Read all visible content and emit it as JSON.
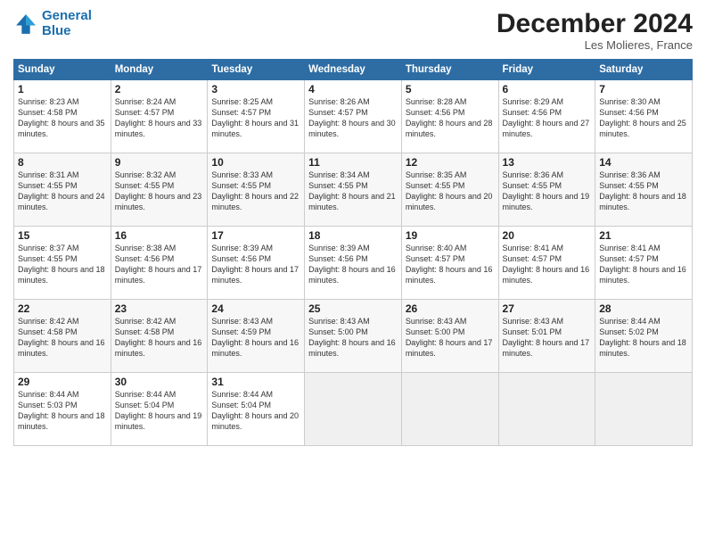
{
  "header": {
    "logo_line1": "General",
    "logo_line2": "Blue",
    "month": "December 2024",
    "location": "Les Molieres, France"
  },
  "weekdays": [
    "Sunday",
    "Monday",
    "Tuesday",
    "Wednesday",
    "Thursday",
    "Friday",
    "Saturday"
  ],
  "weeks": [
    [
      {
        "day": "1",
        "sunrise": "8:23 AM",
        "sunset": "4:58 PM",
        "daylight": "8 hours and 35 minutes."
      },
      {
        "day": "2",
        "sunrise": "8:24 AM",
        "sunset": "4:57 PM",
        "daylight": "8 hours and 33 minutes."
      },
      {
        "day": "3",
        "sunrise": "8:25 AM",
        "sunset": "4:57 PM",
        "daylight": "8 hours and 31 minutes."
      },
      {
        "day": "4",
        "sunrise": "8:26 AM",
        "sunset": "4:57 PM",
        "daylight": "8 hours and 30 minutes."
      },
      {
        "day": "5",
        "sunrise": "8:28 AM",
        "sunset": "4:56 PM",
        "daylight": "8 hours and 28 minutes."
      },
      {
        "day": "6",
        "sunrise": "8:29 AM",
        "sunset": "4:56 PM",
        "daylight": "8 hours and 27 minutes."
      },
      {
        "day": "7",
        "sunrise": "8:30 AM",
        "sunset": "4:56 PM",
        "daylight": "8 hours and 25 minutes."
      }
    ],
    [
      {
        "day": "8",
        "sunrise": "8:31 AM",
        "sunset": "4:55 PM",
        "daylight": "8 hours and 24 minutes."
      },
      {
        "day": "9",
        "sunrise": "8:32 AM",
        "sunset": "4:55 PM",
        "daylight": "8 hours and 23 minutes."
      },
      {
        "day": "10",
        "sunrise": "8:33 AM",
        "sunset": "4:55 PM",
        "daylight": "8 hours and 22 minutes."
      },
      {
        "day": "11",
        "sunrise": "8:34 AM",
        "sunset": "4:55 PM",
        "daylight": "8 hours and 21 minutes."
      },
      {
        "day": "12",
        "sunrise": "8:35 AM",
        "sunset": "4:55 PM",
        "daylight": "8 hours and 20 minutes."
      },
      {
        "day": "13",
        "sunrise": "8:36 AM",
        "sunset": "4:55 PM",
        "daylight": "8 hours and 19 minutes."
      },
      {
        "day": "14",
        "sunrise": "8:36 AM",
        "sunset": "4:55 PM",
        "daylight": "8 hours and 18 minutes."
      }
    ],
    [
      {
        "day": "15",
        "sunrise": "8:37 AM",
        "sunset": "4:55 PM",
        "daylight": "8 hours and 18 minutes."
      },
      {
        "day": "16",
        "sunrise": "8:38 AM",
        "sunset": "4:56 PM",
        "daylight": "8 hours and 17 minutes."
      },
      {
        "day": "17",
        "sunrise": "8:39 AM",
        "sunset": "4:56 PM",
        "daylight": "8 hours and 17 minutes."
      },
      {
        "day": "18",
        "sunrise": "8:39 AM",
        "sunset": "4:56 PM",
        "daylight": "8 hours and 16 minutes."
      },
      {
        "day": "19",
        "sunrise": "8:40 AM",
        "sunset": "4:57 PM",
        "daylight": "8 hours and 16 minutes."
      },
      {
        "day": "20",
        "sunrise": "8:41 AM",
        "sunset": "4:57 PM",
        "daylight": "8 hours and 16 minutes."
      },
      {
        "day": "21",
        "sunrise": "8:41 AM",
        "sunset": "4:57 PM",
        "daylight": "8 hours and 16 minutes."
      }
    ],
    [
      {
        "day": "22",
        "sunrise": "8:42 AM",
        "sunset": "4:58 PM",
        "daylight": "8 hours and 16 minutes."
      },
      {
        "day": "23",
        "sunrise": "8:42 AM",
        "sunset": "4:58 PM",
        "daylight": "8 hours and 16 minutes."
      },
      {
        "day": "24",
        "sunrise": "8:43 AM",
        "sunset": "4:59 PM",
        "daylight": "8 hours and 16 minutes."
      },
      {
        "day": "25",
        "sunrise": "8:43 AM",
        "sunset": "5:00 PM",
        "daylight": "8 hours and 16 minutes."
      },
      {
        "day": "26",
        "sunrise": "8:43 AM",
        "sunset": "5:00 PM",
        "daylight": "8 hours and 17 minutes."
      },
      {
        "day": "27",
        "sunrise": "8:43 AM",
        "sunset": "5:01 PM",
        "daylight": "8 hours and 17 minutes."
      },
      {
        "day": "28",
        "sunrise": "8:44 AM",
        "sunset": "5:02 PM",
        "daylight": "8 hours and 18 minutes."
      }
    ],
    [
      {
        "day": "29",
        "sunrise": "8:44 AM",
        "sunset": "5:03 PM",
        "daylight": "8 hours and 18 minutes."
      },
      {
        "day": "30",
        "sunrise": "8:44 AM",
        "sunset": "5:04 PM",
        "daylight": "8 hours and 19 minutes."
      },
      {
        "day": "31",
        "sunrise": "8:44 AM",
        "sunset": "5:04 PM",
        "daylight": "8 hours and 20 minutes."
      },
      null,
      null,
      null,
      null
    ]
  ],
  "labels": {
    "sunrise": "Sunrise:",
    "sunset": "Sunset:",
    "daylight": "Daylight:"
  }
}
